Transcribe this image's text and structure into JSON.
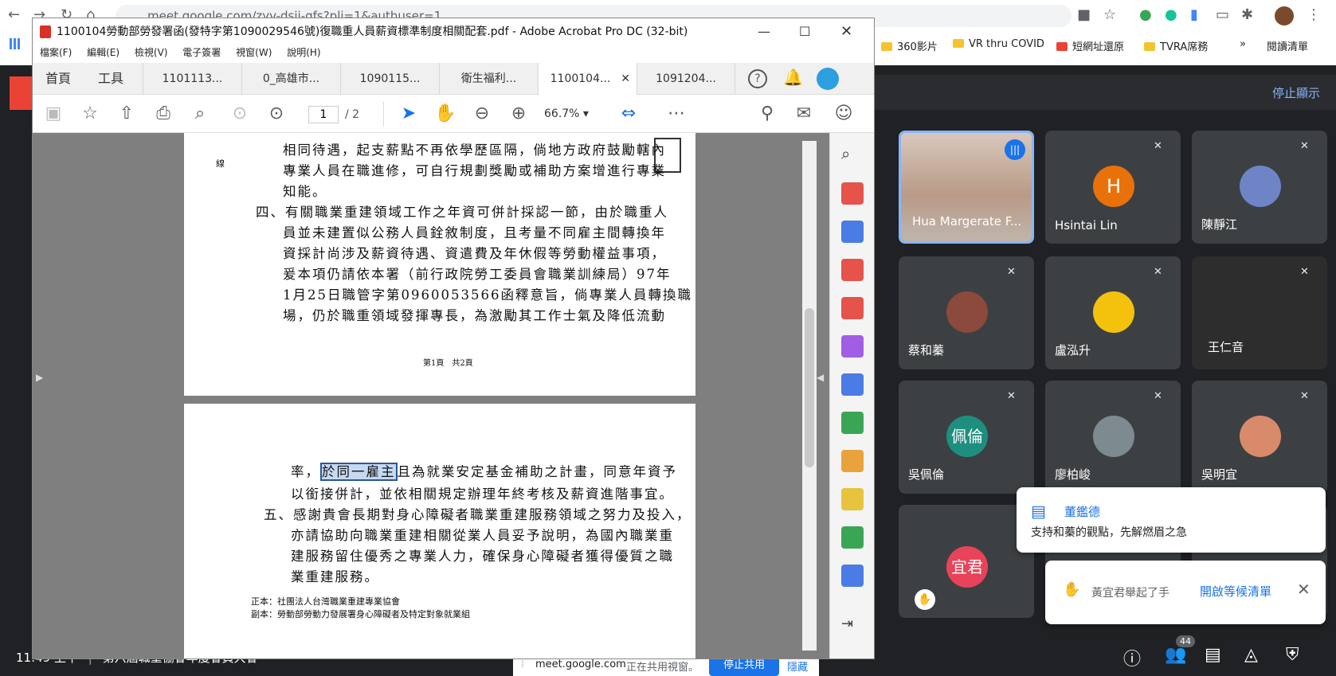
{
  "browser": {
    "url": "meet.google.com/zyv-dsij-gfs?pli=1&authuser=1",
    "bookmarks": [
      "360影片",
      "VR thru COVID",
      "短網址還原",
      "TVRA席務"
    ],
    "reading_list": "閱讀清單"
  },
  "acrobat": {
    "title": "1100104勞動部勞發署函(發特字第1090029546號)復職重人員薪資標準制度相關配套.pdf - Adobe Acrobat Pro DC (32-bit)",
    "menu": [
      "檔案(F)",
      "編輯(E)",
      "檢視(V)",
      "電子簽署",
      "視窗(W)",
      "說明(H)"
    ],
    "tabs": [
      "首頁",
      "工具",
      "1101113...",
      "0_高雄市...",
      "1090115...",
      "衛生福利...",
      "1100104...",
      "1091204..."
    ],
    "page_current": "1",
    "page_total": "/ 2",
    "zoom": "66.7%",
    "page1_lines": [
      "相同待遇，起支薪點不再依學歷區隔，倘地方政府鼓勵轄內",
      "專業人員在職進修，可自行規劃獎勵或補助方案增進行專業",
      "知能。",
      "四、有關職業重建領域工作之年資可併計採認一節，由於職重人",
      "員並未建置似公務人員銓敘制度，且考量不同雇主間轉換年",
      "資採計尚涉及薪資待遇、資遣費及年休假等勞動權益事項，",
      "爰本項仍請依本署（前行政院勞工委員會職業訓練局）97年",
      "1月25日職管字第0960053566函釋意旨，倘專業人員轉換職",
      "場，仍於職重領域發揮專長，為激勵其工作士氣及降低流動"
    ],
    "page1_side": "線",
    "page1_footer": "第1頁　共2頁",
    "page2_lines": [
      "率，",
      "於同一雇主",
      "且為就業安定基金補助之計畫，同意年資予",
      "以銜接併計，並依相關規定辦理年終考核及薪資進階事宜。",
      "五、感謝貴會長期對身心障礙者職業重建服務領域之努力及投入，",
      "亦請協助向職業重建相關從業人員妥予說明，為國內職業重",
      "建服務留住優秀之專業人力，確保身心障礙者獲得優質之職",
      "業重建服務。"
    ],
    "page2_cc": [
      "正本：社團法人台灣職業重建專業協會",
      "副本：勞動部勞動力發展署身心障礙者及特定對象就業組"
    ]
  },
  "meet": {
    "stop_present": "停止顯示",
    "participants": [
      {
        "name": "Hua Margerate F...",
        "initial": "",
        "color": "#c9a68f"
      },
      {
        "name": "Hsintai Lin",
        "initial": "H",
        "color": "#e8710a"
      },
      {
        "name": "陳靜江",
        "initial": "",
        "color": "#6e84c7"
      },
      {
        "name": "蔡和蓁",
        "initial": "",
        "color": "#8b4a3c"
      },
      {
        "name": "盧泓升",
        "initial": "",
        "color": "#f4c20d"
      },
      {
        "name": "王仁音",
        "initial": "",
        "color": "#2d2d2d"
      },
      {
        "name": "吳佩倫",
        "initial": "佩倫",
        "color": "#1e8e7e"
      },
      {
        "name": "廖柏峻",
        "initial": "",
        "color": "#7d8a8f"
      },
      {
        "name": "吳明宜",
        "initial": "",
        "color": "#d98a6b"
      },
      {
        "name": "",
        "initial": "宜君",
        "color": "#e8435a"
      }
    ],
    "chat_sender": "董鑑德",
    "chat_msg": "支持和蓁的觀點，先解燃眉之急",
    "hand_msg": "黃宜君舉起了手",
    "hand_link": "開啟等候清單",
    "share_bar_domain": "meet.google.com",
    "share_bar_text": "正在共用視窗。",
    "share_stop": "停止共用",
    "share_hide": "隱藏",
    "clock": "11:49 上午",
    "meeting_name": "第六屆職重協會年度會員大會",
    "people_count": "44"
  }
}
